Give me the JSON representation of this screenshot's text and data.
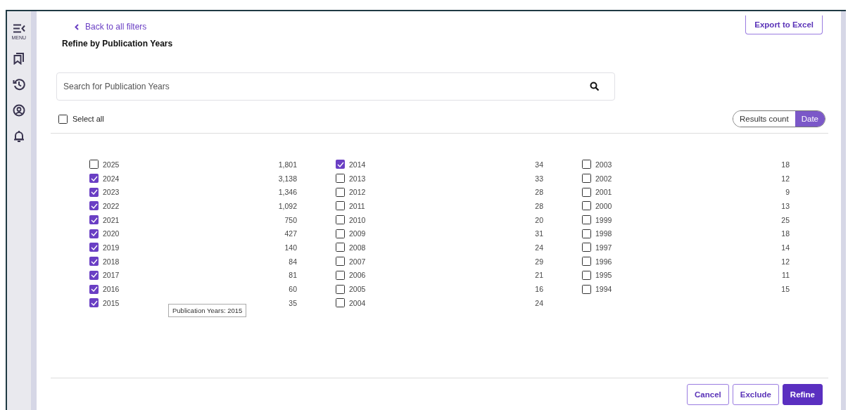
{
  "sidebar": {
    "menu_label": "MENU",
    "items": [
      {
        "kind": "bookmarks"
      },
      {
        "kind": "history"
      },
      {
        "kind": "profile"
      },
      {
        "kind": "alerts"
      }
    ]
  },
  "back_link": "Back to all filters",
  "export_button": "Export to Excel",
  "title": "Refine by Publication Years",
  "search": {
    "placeholder": "Search for Publication Years"
  },
  "select_all": {
    "label": "Select all",
    "checked": false
  },
  "sort_toggle": [
    {
      "label": "Results count",
      "selected": false
    },
    {
      "label": "Date",
      "selected": true
    }
  ],
  "columns": [
    [
      {
        "year": "2025",
        "count": "1,801",
        "checked": false
      },
      {
        "year": "2024",
        "count": "3,138",
        "checked": true
      },
      {
        "year": "2023",
        "count": "1,346",
        "checked": true
      },
      {
        "year": "2022",
        "count": "1,092",
        "checked": true
      },
      {
        "year": "2021",
        "count": "750",
        "checked": true
      },
      {
        "year": "2020",
        "count": "427",
        "checked": true
      },
      {
        "year": "2019",
        "count": "140",
        "checked": true
      },
      {
        "year": "2018",
        "count": "84",
        "checked": true
      },
      {
        "year": "2017",
        "count": "81",
        "checked": true
      },
      {
        "year": "2016",
        "count": "60",
        "checked": true
      },
      {
        "year": "2015",
        "count": "35",
        "checked": true
      }
    ],
    [
      {
        "year": "2014",
        "count": "34",
        "checked": true
      },
      {
        "year": "2013",
        "count": "33",
        "checked": false
      },
      {
        "year": "2012",
        "count": "28",
        "checked": false
      },
      {
        "year": "2011",
        "count": "28",
        "checked": false
      },
      {
        "year": "2010",
        "count": "20",
        "checked": false
      },
      {
        "year": "2009",
        "count": "31",
        "checked": false
      },
      {
        "year": "2008",
        "count": "24",
        "checked": false
      },
      {
        "year": "2007",
        "count": "29",
        "checked": false
      },
      {
        "year": "2006",
        "count": "21",
        "checked": false
      },
      {
        "year": "2005",
        "count": "16",
        "checked": false
      },
      {
        "year": "2004",
        "count": "24",
        "checked": false
      }
    ],
    [
      {
        "year": "2003",
        "count": "18",
        "checked": false
      },
      {
        "year": "2002",
        "count": "12",
        "checked": false
      },
      {
        "year": "2001",
        "count": "9",
        "checked": false
      },
      {
        "year": "2000",
        "count": "13",
        "checked": false
      },
      {
        "year": "1999",
        "count": "25",
        "checked": false
      },
      {
        "year": "1998",
        "count": "18",
        "checked": false
      },
      {
        "year": "1997",
        "count": "14",
        "checked": false
      },
      {
        "year": "1996",
        "count": "12",
        "checked": false
      },
      {
        "year": "1995",
        "count": "11",
        "checked": false
      },
      {
        "year": "1994",
        "count": "15",
        "checked": false
      }
    ]
  ],
  "tooltip": "Publication Years: 2015",
  "footer_buttons": [
    {
      "label": "Cancel",
      "kind": "outline"
    },
    {
      "label": "Exclude",
      "kind": "outline"
    },
    {
      "label": "Refine",
      "kind": "primary"
    }
  ]
}
